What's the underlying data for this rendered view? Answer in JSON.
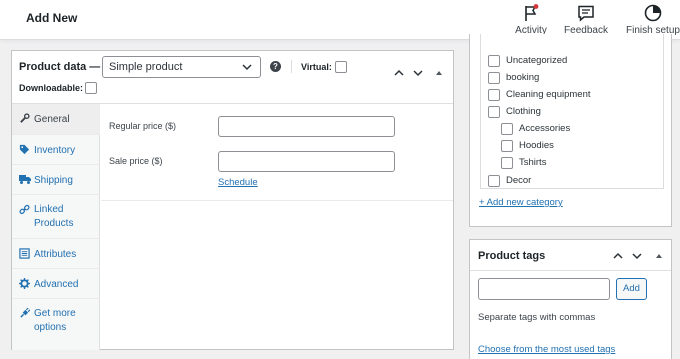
{
  "topbar": {
    "title": "Add New",
    "items": [
      {
        "label": "Activity",
        "icon": "flag-icon"
      },
      {
        "label": "Feedback",
        "icon": "feedback-icon"
      },
      {
        "label": "Finish setup",
        "icon": "progress-circle-icon"
      }
    ]
  },
  "product_data": {
    "title": "Product data —",
    "product_type": "Simple product",
    "help": "?",
    "virtual_label": "Virtual:",
    "downloadable_label": "Downloadable:",
    "tabs": [
      {
        "label": "General",
        "icon": "wrench-icon"
      },
      {
        "label": "Inventory",
        "icon": "tag-icon"
      },
      {
        "label": "Shipping",
        "icon": "truck-icon"
      },
      {
        "label": "Linked Products",
        "icon": "link-icon"
      },
      {
        "label": "Attributes",
        "icon": "list-icon"
      },
      {
        "label": "Advanced",
        "icon": "gear-icon"
      },
      {
        "label": "Get more options",
        "icon": "plugin-icon"
      }
    ],
    "regular_price_label": "Regular price ($)",
    "regular_price_value": "",
    "sale_price_label": "Sale price ($)",
    "sale_price_value": "",
    "schedule_link": "Schedule"
  },
  "categories": {
    "items": [
      {
        "label": "Uncategorized",
        "level": 0,
        "checked": false
      },
      {
        "label": "booking",
        "level": 0,
        "checked": false
      },
      {
        "label": "Cleaning equipment",
        "level": 0,
        "checked": false
      },
      {
        "label": "Clothing",
        "level": 0,
        "checked": false
      },
      {
        "label": "Accessories",
        "level": 1,
        "checked": false
      },
      {
        "label": "Hoodies",
        "level": 1,
        "checked": false
      },
      {
        "label": "Tshirts",
        "level": 1,
        "checked": false
      },
      {
        "label": "Decor",
        "level": 0,
        "checked": false
      }
    ],
    "add_link": "+ Add new category"
  },
  "tags": {
    "title": "Product tags",
    "input_value": "",
    "add_button": "Add",
    "help_text": "Separate tags with commas",
    "most_used_link": "Choose from the most used tags"
  },
  "colors": {
    "link": "#2271b1",
    "border": "#c3c4c7",
    "background": "#f0f0f1"
  }
}
